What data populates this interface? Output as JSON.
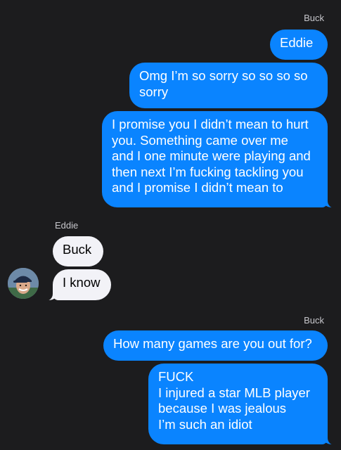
{
  "thread": {
    "groups": [
      {
        "sender": "Buck",
        "messages": [
          "Eddie",
          "Omg I’m so sorry so so so so\nsorry",
          "I promise you I didn’t mean to hurt\nyou. Something came over me\nand I one minute were playing and\nthen next I’m fucking tackling you\nand I promise I didn’t mean to"
        ]
      },
      {
        "sender": "Eddie",
        "messages": [
          "Buck",
          "I know"
        ]
      },
      {
        "sender": "Buck",
        "messages": [
          "How many games are you out for?",
          "FUCK\nI injured a star MLB player\nbecause I was jealous\nI’m such an idiot"
        ]
      }
    ]
  }
}
